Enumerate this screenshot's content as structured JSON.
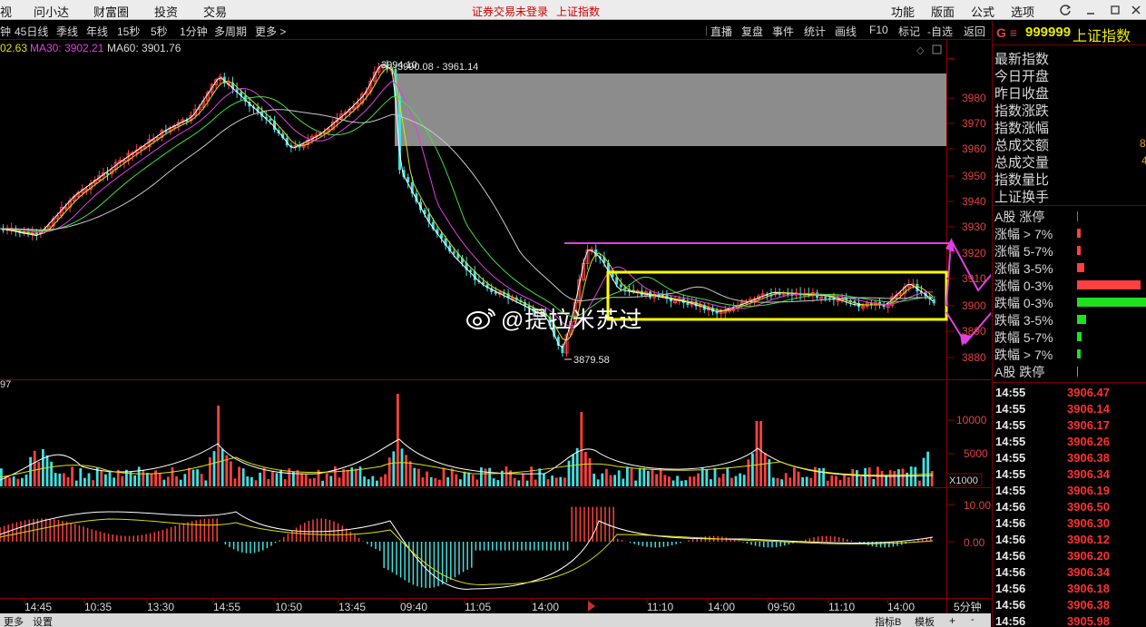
{
  "menubar": {
    "left": [
      "视",
      "问小达",
      "财富圈",
      "投资",
      "交易"
    ],
    "warning": "证券交易未登录",
    "index_name": "上证指数",
    "right": [
      "功能",
      "版面",
      "公式",
      "选项"
    ]
  },
  "toolbar": {
    "periods": [
      "钟",
      "45日线",
      "季线",
      "年线",
      "15秒",
      "5秒",
      "1分钟",
      "多周期",
      "更多 >"
    ],
    "tools": [
      "直播",
      "复盘",
      "事件",
      "统计",
      "画线",
      "F10",
      "标记",
      "-自选",
      "返回"
    ]
  },
  "ma_legend": {
    "ma_prefix": "02.63",
    "ma30": "MA30: 3902.21",
    "ma60": "MA60: 3901.76"
  },
  "price_axis": {
    "labels": [
      "3980",
      "3970",
      "3960",
      "3950",
      "3940",
      "3930",
      "3920",
      "3910",
      "3900",
      "3890",
      "3880"
    ]
  },
  "annotations": {
    "high": "3994.10",
    "range": "3990.08 - 3961.14",
    "low": "3879.58"
  },
  "volume": {
    "label": "97",
    "axis": [
      "10000",
      "5000"
    ],
    "unit": "X1000"
  },
  "macd": {
    "axis": [
      "10.00",
      "0.00"
    ]
  },
  "time_axis": {
    "labels": [
      "14:45",
      "10:35",
      "13:30",
      "14:55",
      "10:50",
      "13:45",
      "09:40",
      "11:05",
      "14:00",
      "11:10",
      "14:00",
      "09:50",
      "11:10",
      "14:00"
    ],
    "period": "5分钟"
  },
  "status_bar": {
    "left": [
      "更多",
      "设置"
    ],
    "right": [
      "指标B",
      "模板"
    ]
  },
  "watermark": "@提拉米苏过",
  "right_panel": {
    "code_prefix": "G ≡",
    "code": "999999",
    "name": "上证指数",
    "fields": [
      "最新指数",
      "今日开盘",
      "昨日收盘",
      "指数涨跌",
      "指数涨幅",
      "总成交额",
      "总成交量",
      "指数量比",
      "上证换手"
    ],
    "field_values": [
      "8",
      "4"
    ],
    "breadth_rows": [
      "A股 涨停",
      "涨幅 > 7%",
      "涨幅 5-7%",
      "涨幅 3-5%",
      "涨幅 0-3%",
      "跌幅 0-3%",
      "跌幅 3-5%",
      "跌幅 5-7%",
      "跌幅 > 7%",
      "A股 跌停"
    ],
    "ticks": [
      {
        "time": "14:55",
        "price": "3906.47"
      },
      {
        "time": "14:55",
        "price": "3906.14"
      },
      {
        "time": "14:55",
        "price": "3906.17"
      },
      {
        "time": "14:55",
        "price": "3906.26"
      },
      {
        "time": "14:55",
        "price": "3906.38"
      },
      {
        "time": "14:55",
        "price": "3906.34"
      },
      {
        "time": "14:55",
        "price": "3906.19"
      },
      {
        "time": "14:56",
        "price": "3906.50"
      },
      {
        "time": "14:56",
        "price": "3906.30"
      },
      {
        "time": "14:56",
        "price": "3906.12"
      },
      {
        "time": "14:56",
        "price": "3906.20"
      },
      {
        "time": "14:56",
        "price": "3906.34"
      },
      {
        "time": "14:56",
        "price": "3906.18"
      },
      {
        "time": "14:56",
        "price": "3906.38"
      },
      {
        "time": "14:56",
        "price": "3905.98"
      }
    ]
  }
}
